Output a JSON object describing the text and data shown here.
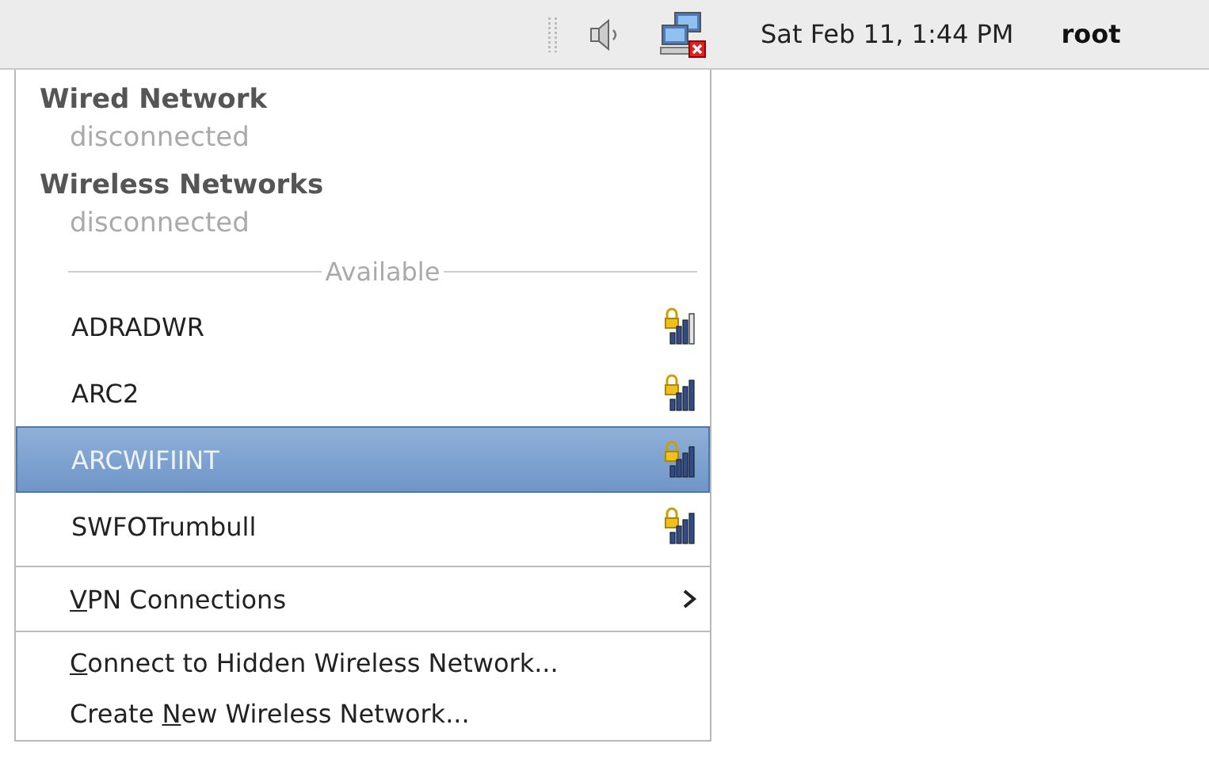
{
  "panel": {
    "clock": "Sat Feb 11,  1:44 PM",
    "user": "root"
  },
  "menu": {
    "sections": [
      {
        "title": "Wired Network",
        "status": "disconnected"
      },
      {
        "title": "Wireless Networks",
        "status": "disconnected"
      }
    ],
    "available_label": "Available",
    "networks": [
      {
        "name": "ADRADWR",
        "secured": true,
        "weak_signal": true,
        "selected": false
      },
      {
        "name": "ARC2",
        "secured": true,
        "weak_signal": false,
        "selected": false
      },
      {
        "name": "ARCWIFIINT",
        "secured": true,
        "weak_signal": false,
        "selected": true
      },
      {
        "name": "SWFOTrumbull",
        "secured": true,
        "weak_signal": false,
        "selected": false
      }
    ],
    "vpn": {
      "key": "V",
      "post": "PN Connections",
      "submenu": true
    },
    "actions": [
      {
        "key": "C",
        "post": "onnect to Hidden Wireless Network..."
      },
      {
        "pre": "Create ",
        "key": "N",
        "post": "ew Wireless Network..."
      }
    ]
  }
}
